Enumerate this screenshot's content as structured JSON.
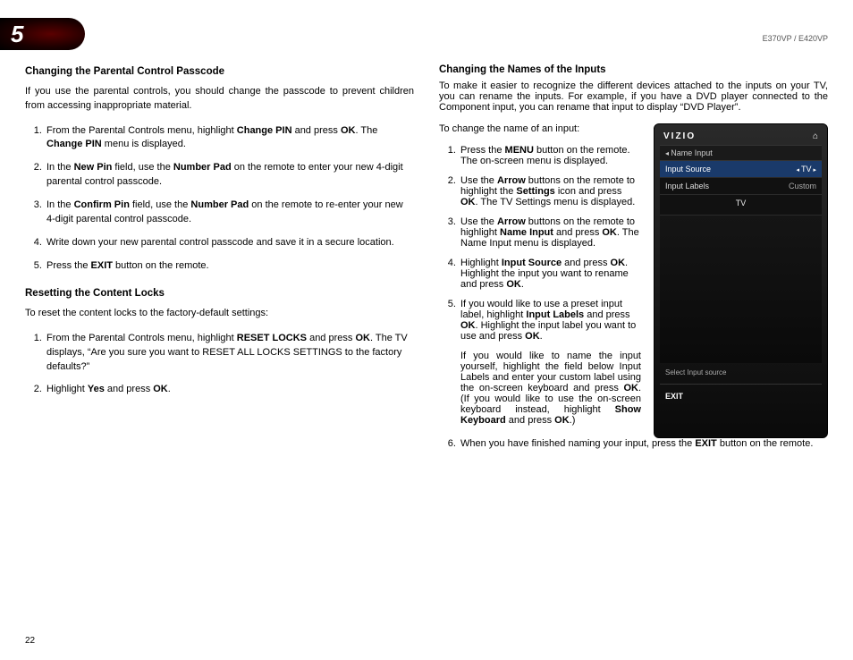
{
  "chapter_number": "5",
  "model_label": "E370VP / E420VP",
  "page_number": "22",
  "left": {
    "h1": "Changing the Parental Control Passcode",
    "p1": "If you use the parental controls, you should change the passcode to prevent children from accessing inappropriate material.",
    "ol1": {
      "i1a": "From the Parental Controls menu, highlight ",
      "i1b": "Change PIN",
      "i1c": " and press ",
      "i1d": "OK",
      "i1e": ". The ",
      "i1f": "Change PIN",
      "i1g": " menu is displayed.",
      "i2a": "In the ",
      "i2b": "New Pin",
      "i2c": " field, use the ",
      "i2d": "Number Pad",
      "i2e": " on the remote to enter your new 4-digit parental control passcode.",
      "i3a": "In the ",
      "i3b": "Confirm Pin",
      "i3c": " field, use the ",
      "i3d": "Number Pad",
      "i3e": " on the remote to re-enter your new 4-digit parental control passcode.",
      "i4": "Write down your new parental control passcode and save it in a secure location.",
      "i5a": "Press the ",
      "i5b": "EXIT",
      "i5c": " button on the remote."
    },
    "h2": "Resetting the Content Locks",
    "p2": "To reset the content locks to the factory-default settings:",
    "ol2": {
      "i1a": "From the Parental Controls menu, highlight ",
      "i1b": "RESET LOCKS",
      "i1c": " and press ",
      "i1d": "OK",
      "i1e": ". The TV displays, “Are you sure you want to RESET ALL LOCKS SETTINGS to the factory defaults?”",
      "i2a": "Highlight ",
      "i2b": "Yes",
      "i2c": " and press ",
      "i2d": "OK",
      "i2e": "."
    }
  },
  "right": {
    "h1": "Changing the Names of the Inputs",
    "p1": "To make it easier to recognize the different devices attached to the inputs on your TV, you can rename the inputs. For example, if you have a DVD player connected to the Component input, you can rename that input to display “DVD Player”.",
    "p2": "To change the name of an input:",
    "ol": {
      "i1a": "Press the ",
      "i1b": "MENU",
      "i1c": " button on the remote. The on-screen menu is displayed.",
      "i2a": "Use the ",
      "i2b": "Arrow",
      "i2c": " buttons on the remote to highlight the ",
      "i2d": "Settings",
      "i2e": " icon and press ",
      "i2f": "OK",
      "i2g": ". The TV Settings menu is displayed.",
      "i3a": "Use the ",
      "i3b": "Arrow",
      "i3c": " buttons on the remote to highlight ",
      "i3d": "Name Input",
      "i3e": " and press ",
      "i3f": "OK",
      "i3g": ". The Name Input menu is displayed.",
      "i4a": "Highlight ",
      "i4b": "Input Source",
      "i4c": " and press ",
      "i4d": "OK",
      "i4e": ". Highlight the input you want to rename and press ",
      "i4f": "OK",
      "i4g": ".",
      "i5a": "If you would like to use a preset input label, highlight ",
      "i5b": "Input Labels",
      "i5c": " and press ",
      "i5d": "OK",
      "i5e": ". Highlight the input label you want to use and press ",
      "i5f": "OK",
      "i5g": ".",
      "i5pa": "If you would like to name the input yourself, highlight the field below Input Labels and enter your custom label using the on-screen keyboard and press ",
      "i5pb": "OK",
      "i5pc": ". (If you would like to use the on-screen keyboard instead, highlight ",
      "i5pd": "Show Keyboard",
      "i5pe": " and press ",
      "i5pf": "OK",
      "i5pg": ".)",
      "i6a": "When you have finished naming your input, press the ",
      "i6b": "EXIT",
      "i6c": " button on the remote."
    }
  },
  "osd": {
    "brand": "VIZIO",
    "crumb": "Name Input",
    "row1_label": "Input Source",
    "row1_value": "TV",
    "row2_label": "Input Labels",
    "row2_value": "Custom",
    "center": "TV",
    "hint": "Select Input source",
    "exit": "EXIT"
  }
}
